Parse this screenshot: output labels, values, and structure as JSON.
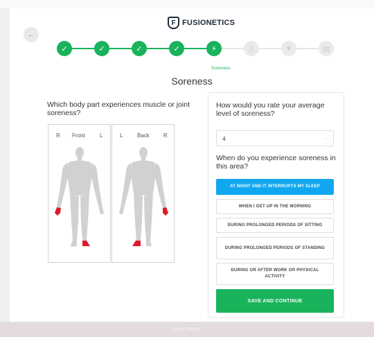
{
  "brand": {
    "name": "FUSIONETICS",
    "mark": "F"
  },
  "colors": {
    "accent": "#19b35b",
    "selected": "#11a7f0",
    "highlight": "#d91b2a"
  },
  "stepper": {
    "steps": [
      {
        "state": "done",
        "icon": "check-icon",
        "glyph": "✓"
      },
      {
        "state": "done",
        "icon": "check-icon",
        "glyph": "✓"
      },
      {
        "state": "done",
        "icon": "check-icon",
        "glyph": "✓"
      },
      {
        "state": "done",
        "icon": "check-icon",
        "glyph": "✓"
      },
      {
        "state": "active",
        "icon": "bolt-icon",
        "glyph": "⚡"
      },
      {
        "state": "todo",
        "icon": "person-icon",
        "glyph": "♙"
      },
      {
        "state": "todo",
        "icon": "heart-icon",
        "glyph": "♥"
      },
      {
        "state": "todo",
        "icon": "clipboard-icon",
        "glyph": "▤"
      }
    ],
    "active_label": "Soreness"
  },
  "page": {
    "title": "Soreness",
    "back_icon": "←"
  },
  "body_question": "Which body part experiences muscle or joint soreness?",
  "front_view": {
    "left": "R",
    "title": "Front",
    "right": "L"
  },
  "back_view": {
    "left": "L",
    "title": "Back",
    "right": "R"
  },
  "rating": {
    "question": "How would you rate your average level of soreness?",
    "value": "4",
    "chevron": "⌄"
  },
  "timing": {
    "question": "When do you experience soreness in this area?",
    "options": [
      {
        "label": "AT NIGHT AND IT INTERRUPTS MY SLEEP",
        "selected": true
      },
      {
        "label": "WHEN I GET UP IN THE MORNING",
        "selected": false
      },
      {
        "label": "DURING PROLONGED PERIODS OF SITTING",
        "selected": false
      },
      {
        "label": "DURING PROLONGED PERIODS OF STANDING",
        "selected": false
      },
      {
        "label": "DURING OR AFTER WORK OR PHYSICAL ACTIVITY",
        "selected": false
      }
    ]
  },
  "save_label": "SAVE AND CONTINUE",
  "footer_label": "CONTINUE"
}
